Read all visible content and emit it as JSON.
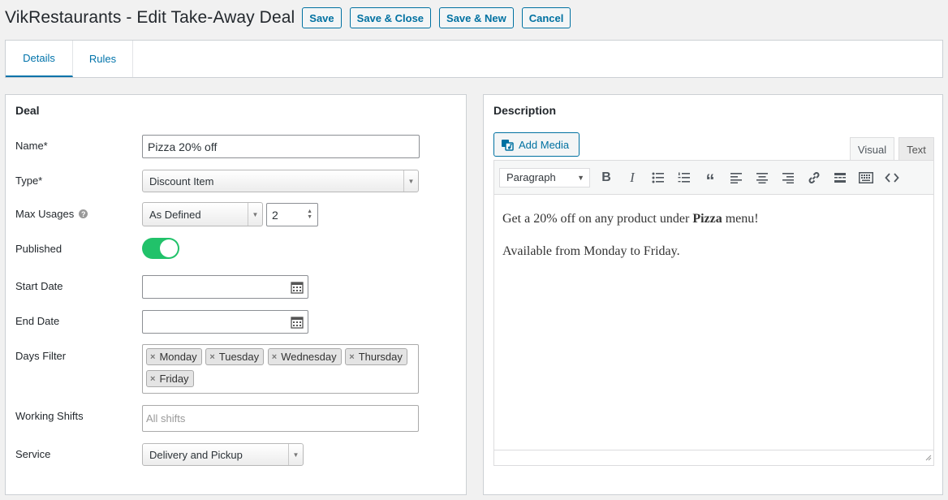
{
  "header": {
    "title": "VikRestaurants - Edit Take-Away Deal",
    "buttons": {
      "save": "Save",
      "save_close": "Save & Close",
      "save_new": "Save & New",
      "cancel": "Cancel"
    }
  },
  "tabs": [
    {
      "label": "Details",
      "active": true
    },
    {
      "label": "Rules",
      "active": false
    }
  ],
  "deal": {
    "title": "Deal",
    "name": {
      "label": "Name*",
      "value": "Pizza 20% off"
    },
    "type": {
      "label": "Type*",
      "value": "Discount Item"
    },
    "max_usages": {
      "label": "Max Usages",
      "mode": "As Defined",
      "count": "2"
    },
    "published": {
      "label": "Published",
      "on": true
    },
    "start_date": {
      "label": "Start Date",
      "value": ""
    },
    "end_date": {
      "label": "End Date",
      "value": ""
    },
    "days_filter": {
      "label": "Days Filter",
      "days": [
        "Monday",
        "Tuesday",
        "Wednesday",
        "Thursday",
        "Friday"
      ]
    },
    "working_shifts": {
      "label": "Working Shifts",
      "placeholder": "All shifts"
    },
    "service": {
      "label": "Service",
      "value": "Delivery and Pickup"
    }
  },
  "description": {
    "title": "Description",
    "add_media_label": "Add Media",
    "modes": {
      "visual": "Visual",
      "text": "Text"
    },
    "format": "Paragraph",
    "para1_before": "Get a 20% off on any product under ",
    "para1_bold": "Pizza",
    "para1_after": " menu!",
    "para2": "Available from Monday to Friday."
  },
  "colors": {
    "accent": "#0071a1",
    "toggle_on": "#21c26a"
  }
}
